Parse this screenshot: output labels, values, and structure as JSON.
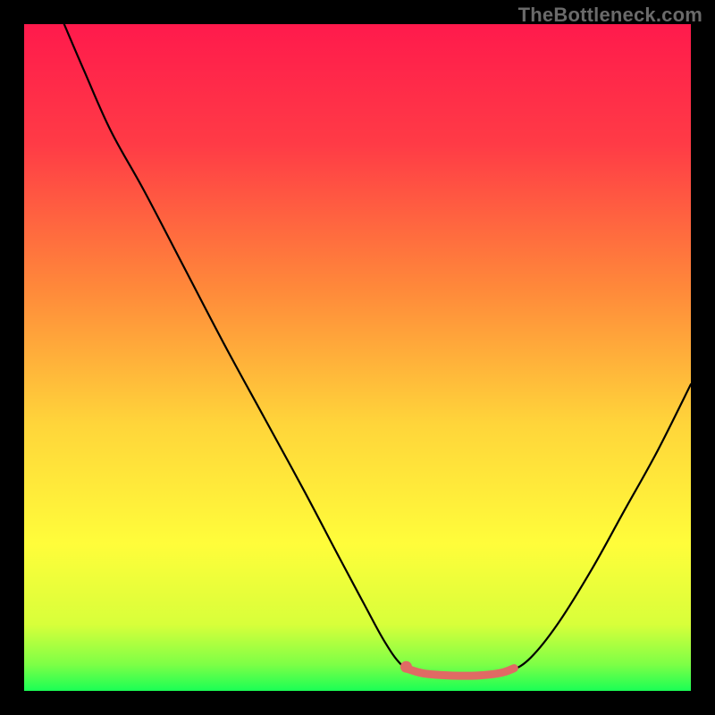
{
  "watermark": "TheBottleneck.com",
  "chart_data": {
    "type": "line",
    "title": "",
    "xlabel": "",
    "ylabel": "",
    "xlim": [
      0,
      100
    ],
    "ylim": [
      0,
      100
    ],
    "gradient": {
      "stops": [
        {
          "offset": 0,
          "color": "#ff1a4c"
        },
        {
          "offset": 18,
          "color": "#ff3b46"
        },
        {
          "offset": 40,
          "color": "#ff8a3a"
        },
        {
          "offset": 60,
          "color": "#ffd53a"
        },
        {
          "offset": 78,
          "color": "#fffd3a"
        },
        {
          "offset": 90,
          "color": "#d8ff3a"
        },
        {
          "offset": 96,
          "color": "#7eff46"
        },
        {
          "offset": 100,
          "color": "#1aff55"
        }
      ]
    },
    "series": [
      {
        "name": "curve",
        "color": "#000000",
        "width": 2.2,
        "points": [
          {
            "x": 6.0,
            "y": 100.0
          },
          {
            "x": 9.0,
            "y": 93.0
          },
          {
            "x": 13.0,
            "y": 84.0
          },
          {
            "x": 18.0,
            "y": 75.0
          },
          {
            "x": 24.0,
            "y": 63.5
          },
          {
            "x": 30.0,
            "y": 52.0
          },
          {
            "x": 36.0,
            "y": 41.0
          },
          {
            "x": 42.0,
            "y": 30.0
          },
          {
            "x": 47.0,
            "y": 20.5
          },
          {
            "x": 51.0,
            "y": 13.0
          },
          {
            "x": 54.0,
            "y": 7.5
          },
          {
            "x": 56.5,
            "y": 4.0
          },
          {
            "x": 59.0,
            "y": 2.5
          },
          {
            "x": 62.0,
            "y": 2.0
          },
          {
            "x": 66.0,
            "y": 2.0
          },
          {
            "x": 70.0,
            "y": 2.3
          },
          {
            "x": 73.0,
            "y": 3.0
          },
          {
            "x": 76.0,
            "y": 5.0
          },
          {
            "x": 80.0,
            "y": 10.0
          },
          {
            "x": 85.0,
            "y": 18.0
          },
          {
            "x": 90.0,
            "y": 27.0
          },
          {
            "x": 95.0,
            "y": 36.0
          },
          {
            "x": 100.0,
            "y": 46.0
          }
        ]
      },
      {
        "name": "highlight-segment",
        "color": "#e06a64",
        "width": 9,
        "linecap": "round",
        "points": [
          {
            "x": 57.5,
            "y": 3.3
          },
          {
            "x": 60.0,
            "y": 2.6
          },
          {
            "x": 64.0,
            "y": 2.3
          },
          {
            "x": 68.0,
            "y": 2.3
          },
          {
            "x": 71.5,
            "y": 2.7
          },
          {
            "x": 73.5,
            "y": 3.4
          }
        ]
      }
    ],
    "marker": {
      "name": "highlight-dot",
      "color": "#e06a64",
      "x": 57.3,
      "y": 3.6,
      "r": 6.5
    }
  }
}
